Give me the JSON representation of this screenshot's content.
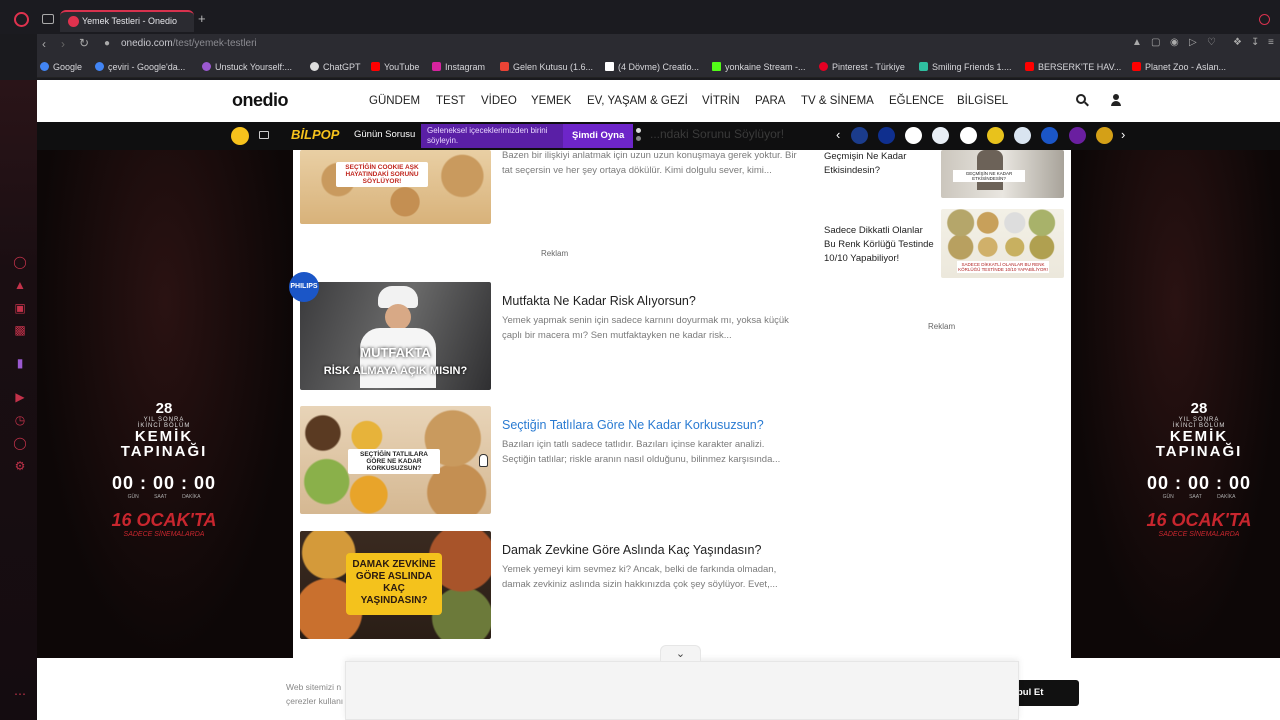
{
  "browser": {
    "tab_title": "Yemek Testleri - Onedio",
    "url_host": "onedio.com",
    "url_path": "/test/yemek-testleri",
    "bookmarks": [
      {
        "label": "Google",
        "color": "#4285f4"
      },
      {
        "label": "çeviri - Google'da...",
        "color": "#4285f4"
      },
      {
        "label": "Unstuck Yourself:...",
        "color": "#9b59d0"
      },
      {
        "label": "ChatGPT",
        "color": "#dddddd"
      },
      {
        "label": "YouTube",
        "color": "#ff0000"
      },
      {
        "label": "Instagram",
        "color": "#d6249f"
      },
      {
        "label": "Gelen Kutusu (1.6...",
        "color": "#ea4335"
      },
      {
        "label": "(4 Dövme) Creatio...",
        "color": "#ffffff"
      },
      {
        "label": "yonkaine Stream -...",
        "color": "#53fc18"
      },
      {
        "label": "Pinterest - Türkiye",
        "color": "#e60023"
      },
      {
        "label": "Smiling Friends 1....",
        "color": "#2fbfa0"
      },
      {
        "label": "BERSERK'TE HAV...",
        "color": "#ff0000"
      },
      {
        "label": "Planet Zoo - Aslan...",
        "color": "#ff0000"
      }
    ]
  },
  "site": {
    "logo": "onedio",
    "nav": [
      "GÜNDEM",
      "TEST",
      "VİDEO",
      "YEMEK",
      "EV, YAŞAM & GEZİ",
      "VİTRİN",
      "PARA",
      "TV & SİNEMA",
      "EĞLENCE",
      "BİLGİSEL"
    ]
  },
  "promo": {
    "brand": "BİLPOP",
    "label": "Günün Sorusu",
    "question": "Geleneksel içeceklerimizden birini söyleyin.",
    "play": "Şimdi Oyna",
    "ghost": "...ndaki Sorunu Söylüyor!"
  },
  "side_ad": {
    "years": "28",
    "years_sub": "YIL SONRA",
    "part": "İKİNCİ BÖLÜM",
    "title_1": "KEMİK",
    "title_2": "TAPINAĞI",
    "timer": "00 : 00 : 00",
    "units": "GÜN SAAT DAKİKA",
    "date": "16 OCAK'TA",
    "tagline": "SADECE SİNEMALARDA"
  },
  "articles": [
    {
      "title": "",
      "desc": "Bazen bir ilişkiyi anlatmak için uzun uzun konuşmaya gerek yoktur. Bir tat seçersin ve her şey ortaya dökülür. Kimi dolgulu sever, kimi...",
      "caption": "SEÇTİĞİN COOKIE AŞK HAYATINDAKİ SORUNU SÖYLÜYOR!"
    },
    {
      "title": "Mutfakta Ne Kadar Risk Alıyorsun?",
      "desc": "Yemek yapmak senin için sadece karnını doyurmak mı, yoksa küçük çaplı bir macera mı? Sen mutfaktayken ne kadar risk...",
      "caption_1": "MUTFAKTA",
      "caption_2": "RİSK ALMAYA AÇIK MISIN?"
    },
    {
      "title": "Seçtiğin Tatlılara Göre Ne Kadar Korkusuzsun?",
      "desc": "Bazıları için tatlı sadece tatlıdır. Bazıları içinse karakter analizi. Seçtiğin tatlılar; riskle aranın nasıl olduğunu, bilinmez karşısında...",
      "caption": "SEÇTİĞİN TATLILARA GÖRE NE KADAR KORKUSUZSUN?"
    },
    {
      "title": "Damak Zevkine Göre Aslında Kaç Yaşındasın?",
      "desc": "Yemek yemeyi kim sevmez ki? Ancak, belki de farkında olmadan, damak zevkiniz aslında sizin hakkınızda çok şey söylüyor. Evet,...",
      "caption": "DAMAK ZEVKİNE GÖRE ASLINDA KAÇ YAŞINDASIN?"
    }
  ],
  "sponsor_badge": "PHILIPS",
  "reklam": "Reklam",
  "sidebar": [
    {
      "title": "Geçmişin Ne Kadar Etkisindesin?",
      "caption": "GEÇMİŞİN NE KADAR ETKİSİNDESİN?"
    },
    {
      "title": "Sadece Dikkatli Olanlar Bu Renk Körlüğü Testinde 10/10 Yapabiliyor!",
      "caption": "SADECE DİKKATLİ OLANLAR BU RENK KÖRLÜĞÜ TESTİNDE 10/10 YAPABİLİYOR!"
    }
  ],
  "cookie": {
    "text_1": "Web sitemizi n",
    "text_2": "çerezler kullanı",
    "button": "bul Et"
  },
  "colors": {
    "accent": "#d8324e",
    "link": "#2a7bd2",
    "promo_purple": "#5a1fa6"
  }
}
